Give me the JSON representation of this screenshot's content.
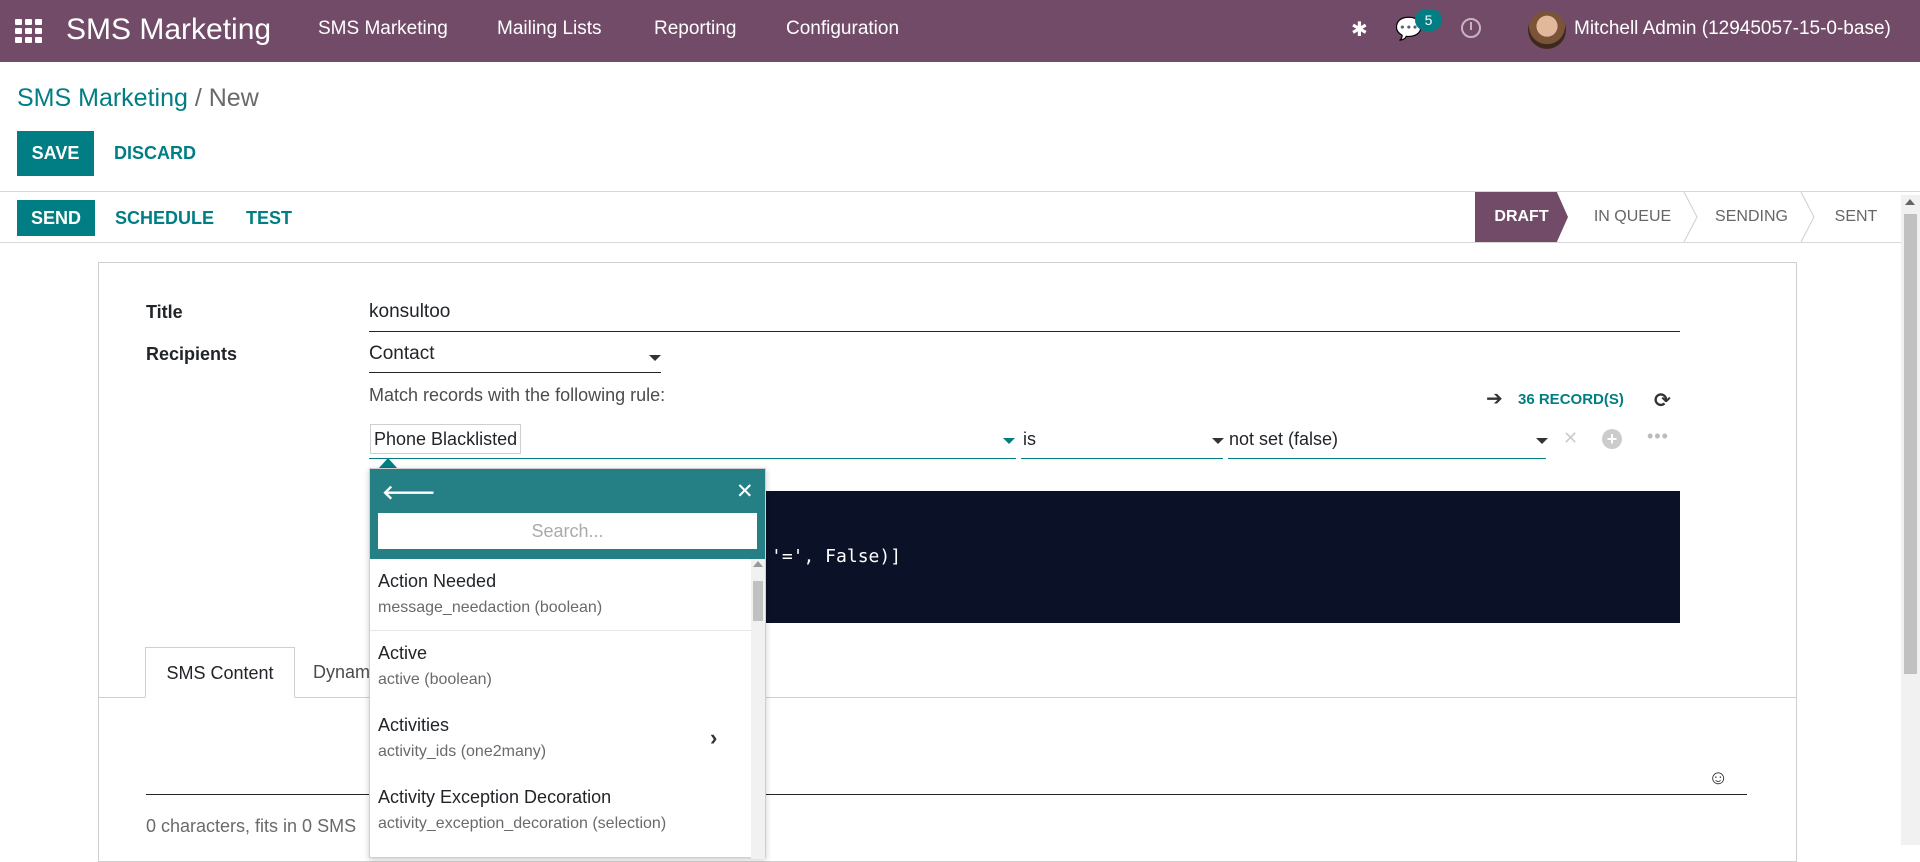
{
  "navbar": {
    "brand": "SMS Marketing",
    "menu": [
      "SMS Marketing",
      "Mailing Lists",
      "Reporting",
      "Configuration"
    ],
    "messages_count": "5",
    "user": "Mitchell Admin (12945057-15-0-base)",
    "accent_color": "#714b67"
  },
  "breadcrumb": {
    "parent": "SMS Marketing",
    "separator": " / ",
    "current": "New"
  },
  "actions": {
    "save": "SAVE",
    "discard": "DISCARD"
  },
  "statusbar": {
    "buttons": {
      "send": "SEND",
      "schedule": "SCHEDULE",
      "test": "TEST"
    },
    "stages": [
      "DRAFT",
      "IN QUEUE",
      "SENDING",
      "SENT"
    ],
    "active_stage": "DRAFT"
  },
  "form": {
    "title_label": "Title",
    "title_value": "konsultoo",
    "recipients_label": "Recipients",
    "recipients_value": "Contact",
    "match_text": "Match records with the following rule:",
    "records": "36 RECORD(S)",
    "rule": {
      "field": "Phone Blacklisted",
      "operator": "is",
      "value": "not set (false)"
    },
    "code_text": "'=', False)]"
  },
  "field_selector": {
    "search_placeholder": "Search...",
    "items": [
      {
        "label": "Action Needed",
        "sub": "message_needaction (boolean)",
        "has_children": false
      },
      {
        "label": "Active",
        "sub": "active (boolean)",
        "has_children": false
      },
      {
        "label": "Activities",
        "sub": "activity_ids (one2many)",
        "has_children": true
      },
      {
        "label": "Activity Exception Decoration",
        "sub": "activity_exception_decoration (selection)",
        "has_children": false
      }
    ]
  },
  "tabs": {
    "sms_content": "SMS Content",
    "dynamic": "Dynam"
  },
  "sms": {
    "char_info": "0 characters, fits in 0 SMS"
  }
}
